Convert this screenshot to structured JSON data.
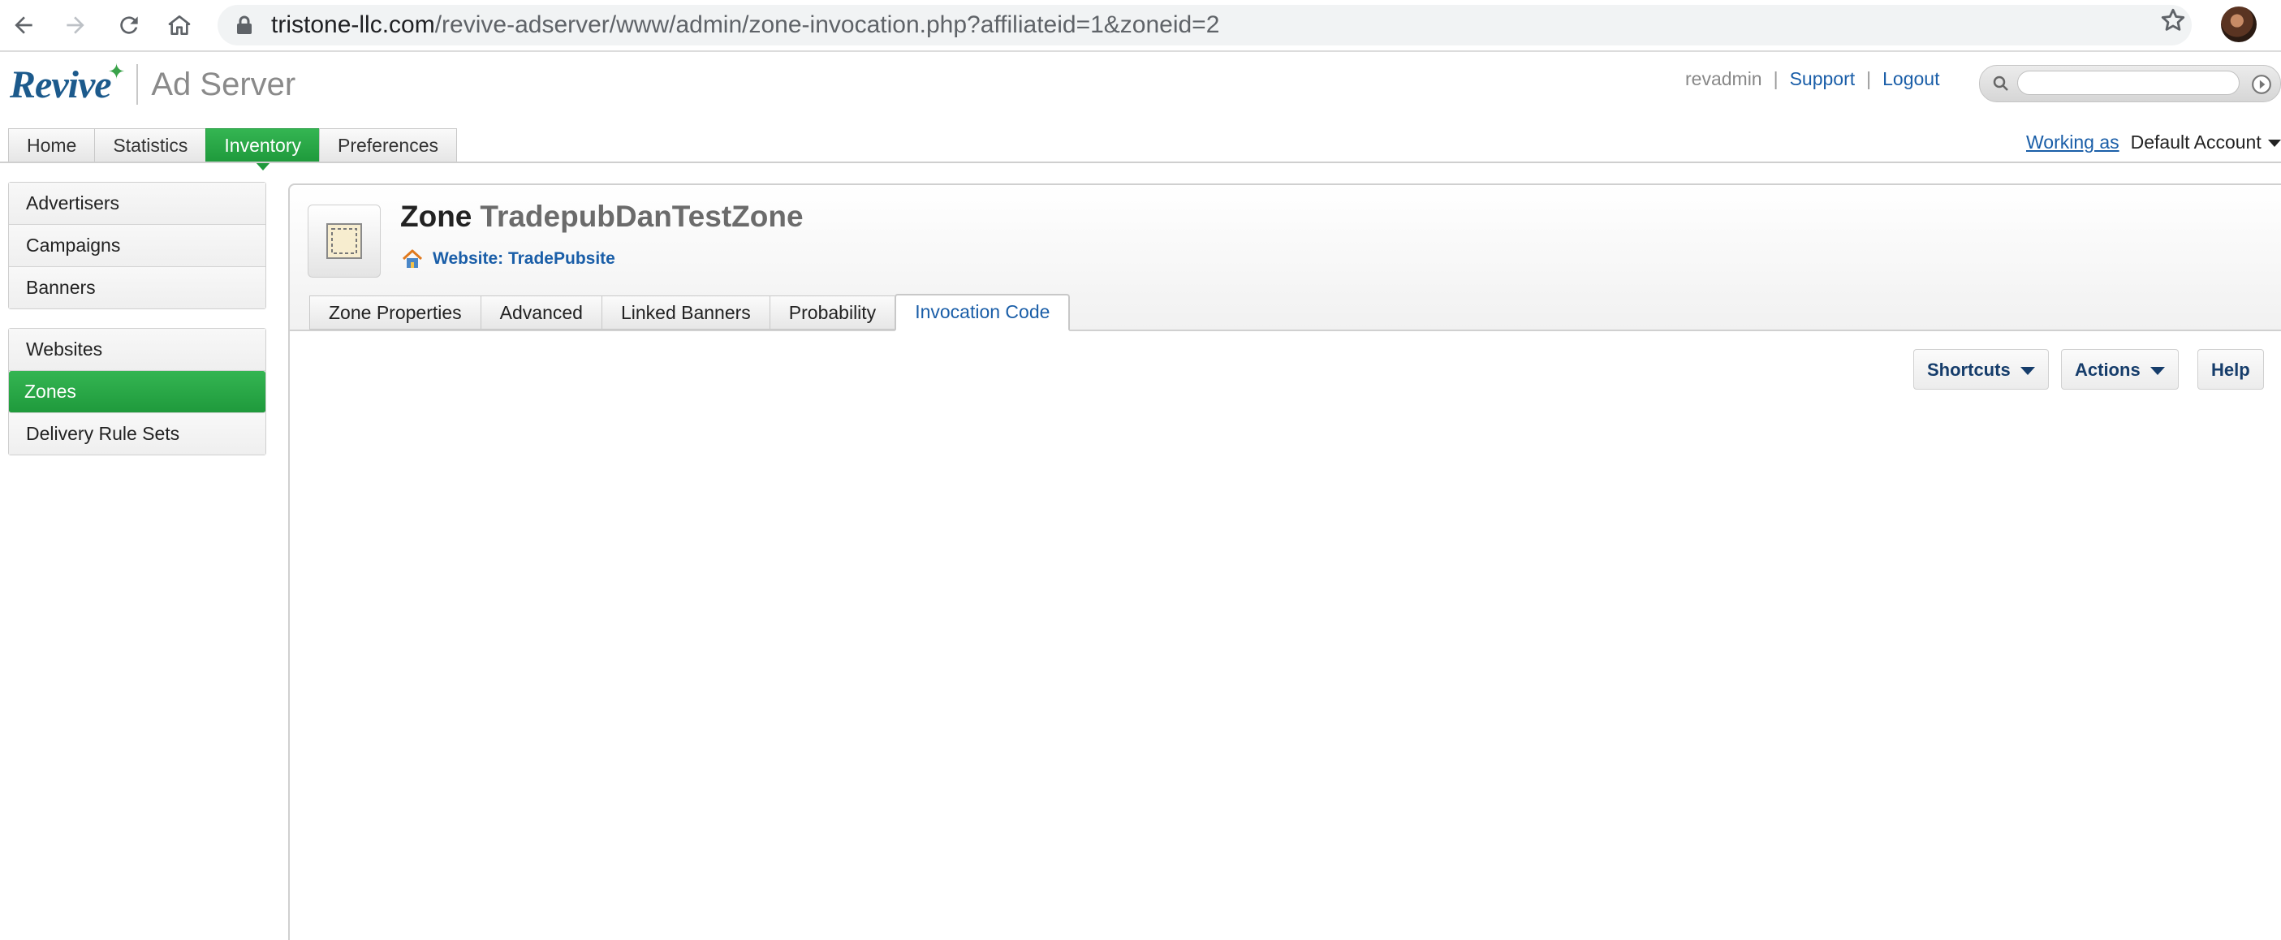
{
  "browser": {
    "url_host": "tristone-llc.com",
    "url_path": "/revive-adserver/www/admin/zone-invocation.php?affiliateid=1&zoneid=2"
  },
  "header": {
    "logo_text": "Revive",
    "product_text": "Ad Server",
    "username": "revadmin",
    "support_label": "Support",
    "logout_label": "Logout",
    "search_placeholder": "",
    "working_as_label": "Working as",
    "account_name": "Default Account"
  },
  "main_tabs": [
    {
      "label": "Home"
    },
    {
      "label": "Statistics"
    },
    {
      "label": "Inventory"
    },
    {
      "label": "Preferences"
    }
  ],
  "sidebar": {
    "group1": [
      {
        "label": "Advertisers"
      },
      {
        "label": "Campaigns"
      },
      {
        "label": "Banners"
      }
    ],
    "group2": [
      {
        "label": "Websites"
      },
      {
        "label": "Zones"
      },
      {
        "label": "Delivery Rule Sets"
      }
    ]
  },
  "zone": {
    "label": "Zone",
    "name": "TradepubDanTestZone",
    "website_link": "Website: TradePubsite"
  },
  "sub_tabs": [
    {
      "label": "Zone Properties"
    },
    {
      "label": "Advanced"
    },
    {
      "label": "Linked Banners"
    },
    {
      "label": "Probability"
    },
    {
      "label": "Invocation Code"
    }
  ],
  "toolbar": {
    "shortcuts_label": "Shortcuts",
    "actions_label": "Actions",
    "help_label": "Help"
  },
  "colors": {
    "active_green": "#2aa84a",
    "link_blue": "#1a5ea8",
    "button_text": "#163d6b"
  }
}
